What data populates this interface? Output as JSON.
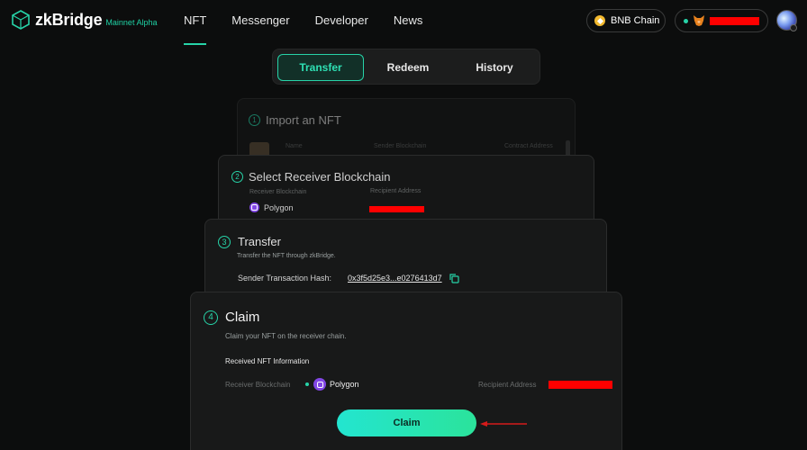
{
  "header": {
    "logo_text": "zkBridge",
    "logo_sub": "Mainnet Alpha",
    "nav": [
      "NFT",
      "Messenger",
      "Developer",
      "News"
    ],
    "chain_label": "BNB Chain"
  },
  "tabs": [
    "Transfer",
    "Redeem",
    "History"
  ],
  "step1": {
    "number": "1",
    "title": "Import an NFT",
    "columns": [
      "Name",
      "Sender Blockchain",
      "Contract Address"
    ]
  },
  "step2": {
    "number": "2",
    "title": "Select Receiver Blockchain",
    "receiver_label": "Receiver Blockchain",
    "recipient_label": "Recipient Address",
    "receiver_value": "Polygon"
  },
  "step3": {
    "number": "3",
    "title": "Transfer",
    "subtitle": "Transfer the NFT through zkBridge.",
    "hash_label": "Sender Transaction Hash:",
    "hash_value": "0x3f5d25e3...e0276413d7"
  },
  "step4": {
    "number": "4",
    "title": "Claim",
    "subtitle": "Claim your NFT on the receiver chain.",
    "info_heading": "Received NFT Information",
    "receiver_label": "Receiver Blockchain",
    "receiver_value": "Polygon",
    "recipient_label": "Recipient Address",
    "claim_label": "Claim"
  },
  "colors": {
    "accent": "#27d3a8",
    "background": "#0c0d0d",
    "redaction": "#ff0000",
    "arrow": "#d61a1a"
  }
}
